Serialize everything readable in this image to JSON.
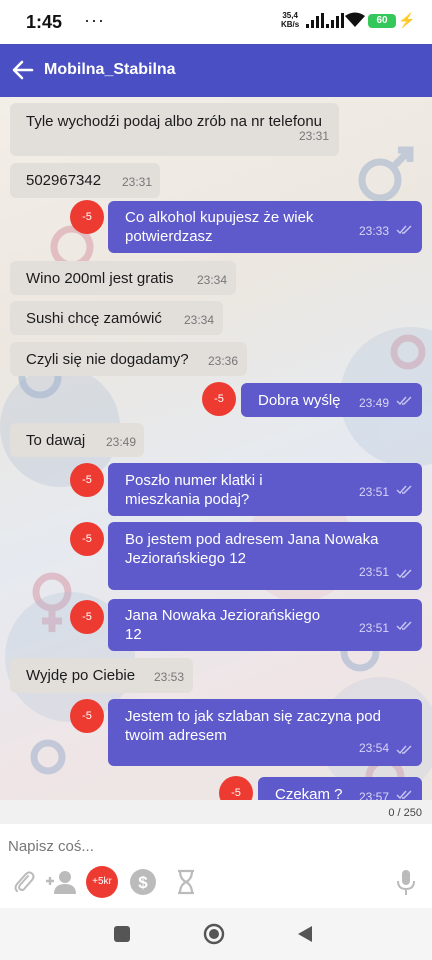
{
  "status_bar": {
    "time": "1:45",
    "dots": "···",
    "net_speed_value": "35,4",
    "net_speed_unit": "KB/s",
    "battery": "60"
  },
  "header": {
    "title": "Mobilna_Stabilna"
  },
  "messages": [
    {
      "direction": "incoming",
      "text": "Tyle wychodźi podaj albo zrób na nr telefonu",
      "time": "23:31"
    },
    {
      "direction": "incoming",
      "text": "502967342",
      "time": "23:31"
    },
    {
      "direction": "outgoing",
      "text": "Co alkohol kupujesz że wiek potwierdzasz",
      "time": "23:33",
      "badge": "-5",
      "read_icon": "double-check-icon"
    },
    {
      "direction": "incoming",
      "text": "Wino 200ml jest gratis",
      "time": "23:34"
    },
    {
      "direction": "incoming",
      "text": "Sushi chcę zamówić",
      "time": "23:34"
    },
    {
      "direction": "incoming",
      "text": "Czyli się nie dogadamy?",
      "time": "23:36"
    },
    {
      "direction": "outgoing",
      "text": "Dobra wyślę",
      "time": "23:49",
      "badge": "-5",
      "read_icon": "double-check-icon"
    },
    {
      "direction": "incoming",
      "text": "To dawaj",
      "time": "23:49"
    },
    {
      "direction": "outgoing",
      "text": "Poszło numer klatki i mieszkania podaj?",
      "time": "23:51",
      "badge": "-5",
      "read_icon": "double-check-icon"
    },
    {
      "direction": "outgoing",
      "text": "Bo jestem pod adresem Jana Nowaka Jeziorańskiego 12",
      "time": "23:51",
      "badge": "-5",
      "read_icon": "double-check-icon"
    },
    {
      "direction": "outgoing",
      "text": "Jana Nowaka Jeziorańskiego 12",
      "time": "23:51",
      "badge": "-5",
      "read_icon": "double-check-icon"
    },
    {
      "direction": "incoming",
      "text": "Wyjdę po Ciebie",
      "time": "23:53"
    },
    {
      "direction": "outgoing",
      "text": "Jestem to jak szlaban się zaczyna pod twoim adresem",
      "time": "23:54",
      "badge": "-5",
      "read_icon": "double-check-icon"
    },
    {
      "direction": "outgoing",
      "text": "Czekam ?",
      "time": "23:57",
      "badge": "-5",
      "read_icon": "double-check-icon"
    }
  ],
  "composer": {
    "char_counter": "0 / 250",
    "placeholder": "Napisz coś...",
    "tip_label": "+5kr",
    "icons": [
      "paperclip-icon",
      "add-contact-icon",
      "dollar-coin-icon",
      "hourglass-icon",
      "microphone-icon"
    ]
  },
  "colors": {
    "header": "#4a4fc4",
    "outgoing_bubble": "#5e5acb",
    "incoming_bubble": "#e2dfdb",
    "badge": "#ee3b32"
  }
}
